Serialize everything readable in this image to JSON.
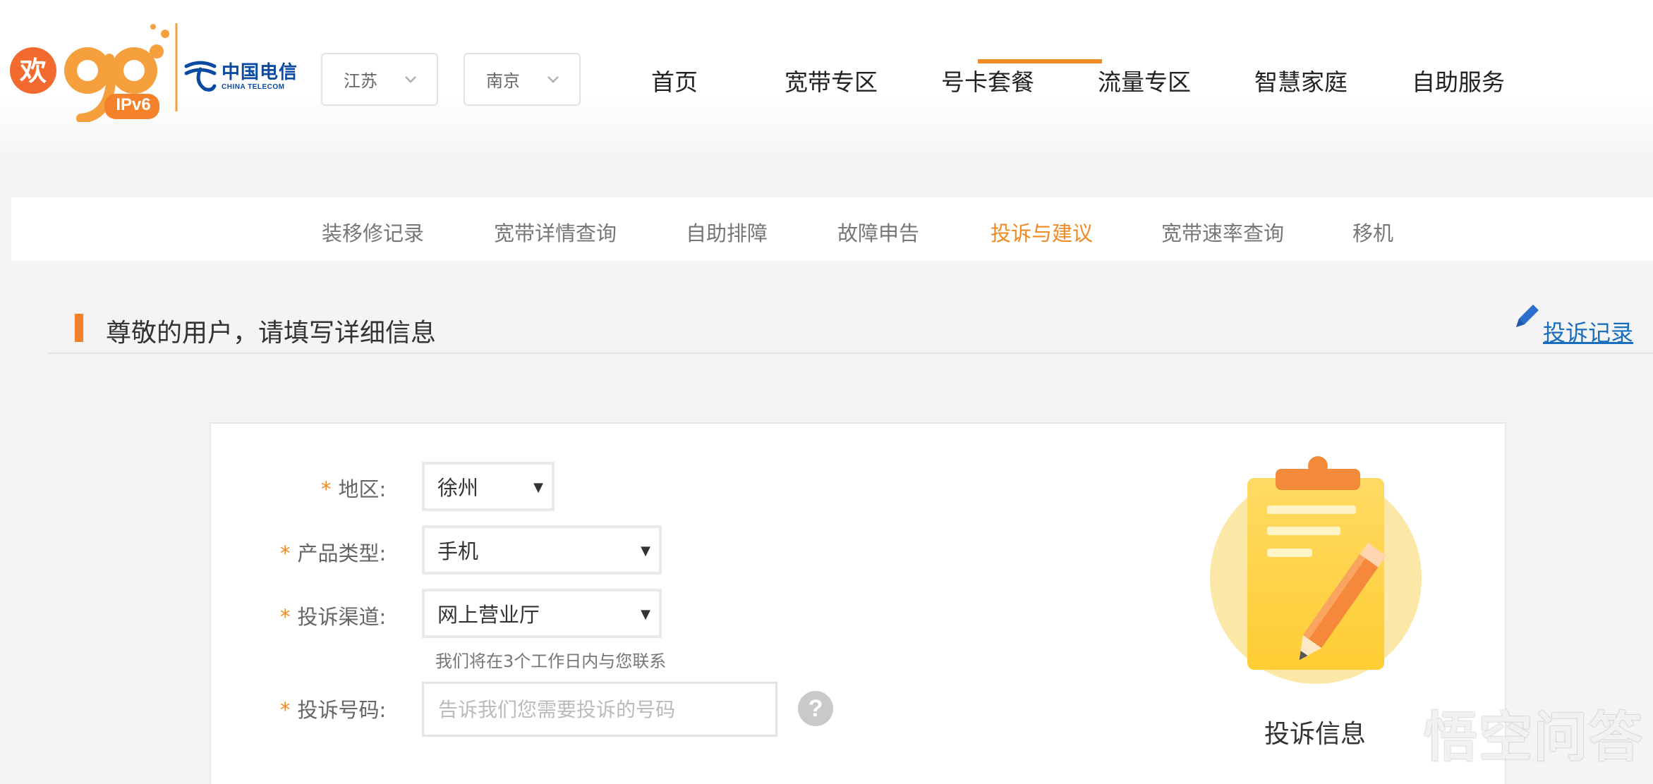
{
  "brand": {
    "logo_text": "欢go",
    "logo_badge": "IPv6",
    "carrier_cn": "中国电信",
    "carrier_en": "CHINA TELECOM",
    "accent_color": "#f08a24"
  },
  "location": {
    "province": "江苏",
    "city": "南京"
  },
  "nav": {
    "items": [
      "首页",
      "宽带专区",
      "号卡套餐",
      "流量专区",
      "智慧家庭",
      "自助服务"
    ]
  },
  "subnav": {
    "items": [
      "装移修记录",
      "宽带详情查询",
      "自助排障",
      "故障申告",
      "投诉与建议",
      "宽带速率查询",
      "移机"
    ],
    "active": "投诉与建议"
  },
  "section": {
    "title": "尊敬的用户，请填写详细信息",
    "record_link": "投诉记录"
  },
  "form": {
    "required_mark": "*",
    "region_label": "地区:",
    "region_value": "徐州",
    "product_label": "产品类型:",
    "product_value": "手机",
    "channel_label": "投诉渠道:",
    "channel_value": "网上营业厅",
    "channel_hint": "我们将在3个工作日内与您联系",
    "number_label": "投诉号码:",
    "number_placeholder": "告诉我们您需要投诉的号码",
    "help_glyph": "?"
  },
  "illustration": {
    "caption": "投诉信息"
  },
  "watermark": {
    "text": "悟空问答"
  }
}
